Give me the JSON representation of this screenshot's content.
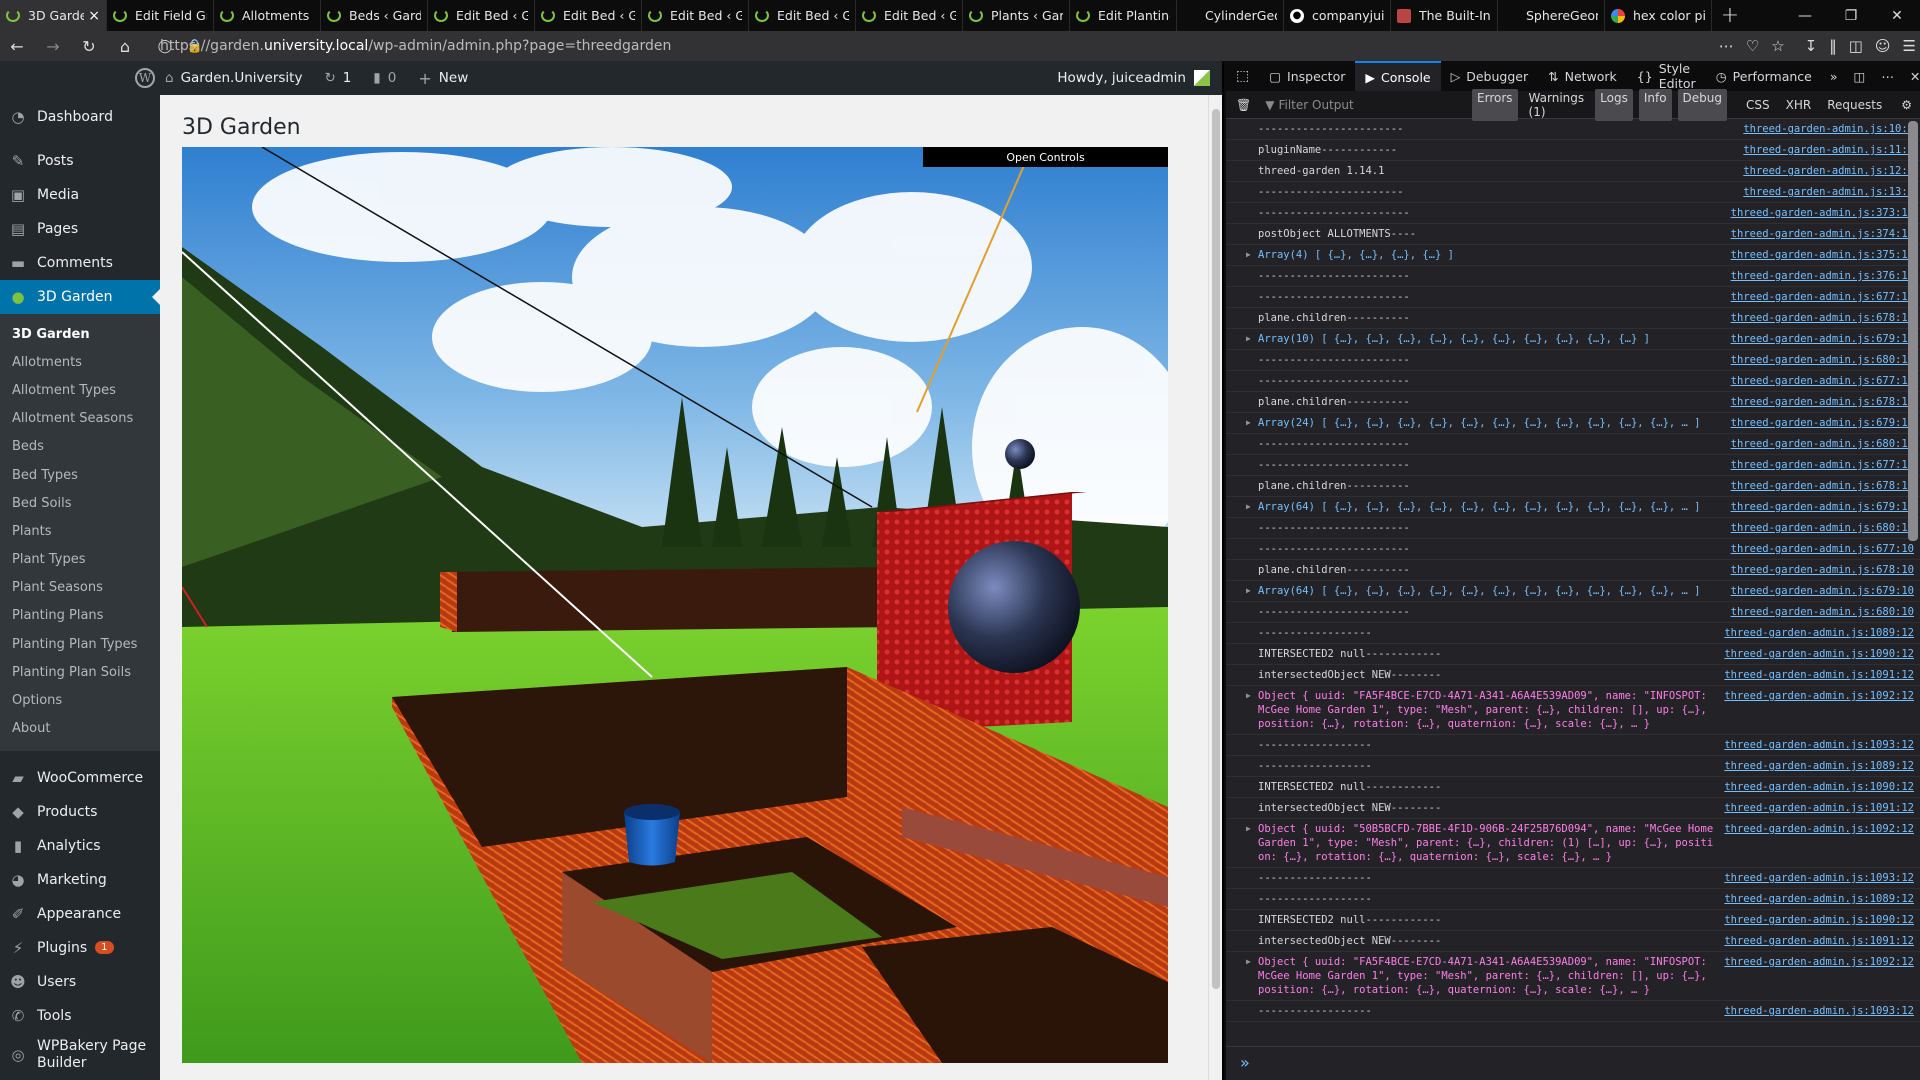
{
  "browser": {
    "tabs": [
      {
        "title": "3D Garden",
        "icon": "wp-icon",
        "active": true
      },
      {
        "title": "Edit Field Gr",
        "icon": "wp-icon"
      },
      {
        "title": "Allotments",
        "icon": "wp-icon"
      },
      {
        "title": "Beds ‹ Garde",
        "icon": "wp-icon"
      },
      {
        "title": "Edit Bed ‹ Ga",
        "icon": "wp-icon"
      },
      {
        "title": "Edit Bed ‹ Ga",
        "icon": "wp-icon"
      },
      {
        "title": "Edit Bed ‹ Ga",
        "icon": "wp-icon"
      },
      {
        "title": "Edit Bed ‹ Ga",
        "icon": "wp-icon"
      },
      {
        "title": "Edit Bed ‹ Ga",
        "icon": "wp-icon"
      },
      {
        "title": "Plants ‹ Gard",
        "icon": "wp-icon"
      },
      {
        "title": "Edit Planting",
        "icon": "wp-icon"
      },
      {
        "title": "CylinderGeo",
        "icon": "threejs-icon"
      },
      {
        "title": "companyjui",
        "icon": "github-icon"
      },
      {
        "title": "The Built-In",
        "icon": "doc-icon"
      },
      {
        "title": "SphereGeom",
        "icon": "threejs-icon"
      },
      {
        "title": "hex color pi",
        "icon": "google-icon"
      }
    ],
    "url_prefix": "https://garden.",
    "url_domain": "university.local",
    "url_path": "/wp-admin/admin.php?page=threedgarden"
  },
  "adminbar": {
    "site_name": "Garden.University",
    "updates": "1",
    "comments": "0",
    "new_label": "New",
    "howdy": "Howdy, juiceadmin"
  },
  "sidebar": {
    "top": [
      {
        "label": "Dashboard",
        "icon": "dashboard-icon"
      }
    ],
    "main": [
      {
        "label": "Posts",
        "icon": "pin-icon"
      },
      {
        "label": "Media",
        "icon": "media-icon"
      },
      {
        "label": "Pages",
        "icon": "pages-icon"
      },
      {
        "label": "Comments",
        "icon": "comment-icon"
      },
      {
        "label": "3D Garden",
        "icon": "garden-icon",
        "current": true
      }
    ],
    "submenu": [
      "3D Garden",
      "Allotments",
      "Allotment Types",
      "Allotment Seasons",
      "Beds",
      "Bed Types",
      "Bed Soils",
      "Plants",
      "Plant Types",
      "Plant Seasons",
      "Planting Plans",
      "Planting Plan Types",
      "Planting Plan Soils",
      "Options",
      "About"
    ],
    "lower": [
      {
        "label": "WooCommerce",
        "icon": "woo-icon"
      },
      {
        "label": "Products",
        "icon": "products-icon"
      },
      {
        "label": "Analytics",
        "icon": "analytics-icon"
      },
      {
        "label": "Marketing",
        "icon": "marketing-icon"
      },
      {
        "label": "Appearance",
        "icon": "brush-icon"
      },
      {
        "label": "Plugins",
        "icon": "plugin-icon",
        "badge": "1"
      },
      {
        "label": "Users",
        "icon": "users-icon"
      },
      {
        "label": "Tools",
        "icon": "wrench-icon"
      },
      {
        "label": "WPBakery Page Builder",
        "icon": "builder-icon"
      }
    ]
  },
  "page": {
    "title": "3D Garden",
    "open_controls": "Open Controls"
  },
  "devtools": {
    "tabs": [
      "Inspector",
      "Console",
      "Debugger",
      "Network",
      "Style Editor",
      "Performance"
    ],
    "active_tab": "Console",
    "filter_placeholder": "Filter Output",
    "levels": [
      {
        "label": "Errors",
        "on": true
      },
      {
        "label": "Warnings (1)",
        "on": false
      },
      {
        "label": "Logs",
        "on": true
      },
      {
        "label": "Info",
        "on": true
      },
      {
        "label": "Debug",
        "on": true
      }
    ],
    "extra_filters": [
      "CSS",
      "XHR",
      "Requests"
    ],
    "log": [
      {
        "text": "-----------------------",
        "src": "threed-garden-admin.js:10:9"
      },
      {
        "text": "pluginName------------",
        "src": "threed-garden-admin.js:11:9"
      },
      {
        "text": "threed-garden 1.14.1",
        "src": "threed-garden-admin.js:12:9"
      },
      {
        "text": "-----------------------",
        "src": "threed-garden-admin.js:13:9"
      },
      {
        "text": "------------------------",
        "src": "threed-garden-admin.js:373:10"
      },
      {
        "text": "postObject ALLOTMENTS----",
        "src": "threed-garden-admin.js:374:10"
      },
      {
        "text": "Array(4) [ {…}, {…}, {…}, {…} ]",
        "src": "threed-garden-admin.js:375:10",
        "kind": "array"
      },
      {
        "text": "------------------------",
        "src": "threed-garden-admin.js:376:10"
      },
      {
        "text": "------------------------",
        "src": "threed-garden-admin.js:677:10"
      },
      {
        "text": "plane.children----------",
        "src": "threed-garden-admin.js:678:10"
      },
      {
        "text": "Array(10) [ {…}, {…}, {…}, {…}, {…}, {…}, {…}, {…}, {…}, {…} ]",
        "src": "threed-garden-admin.js:679:10",
        "kind": "array"
      },
      {
        "text": "------------------------",
        "src": "threed-garden-admin.js:680:10"
      },
      {
        "text": "------------------------",
        "src": "threed-garden-admin.js:677:10"
      },
      {
        "text": "plane.children----------",
        "src": "threed-garden-admin.js:678:10"
      },
      {
        "text": "Array(24) [ {…}, {…}, {…}, {…}, {…}, {…}, {…}, {…}, {…}, {…}, {…}, … ]",
        "src": "threed-garden-admin.js:679:10",
        "kind": "array"
      },
      {
        "text": "------------------------",
        "src": "threed-garden-admin.js:680:10"
      },
      {
        "text": "------------------------",
        "src": "threed-garden-admin.js:677:10"
      },
      {
        "text": "plane.children----------",
        "src": "threed-garden-admin.js:678:10"
      },
      {
        "text": "Array(64) [ {…}, {…}, {…}, {…}, {…}, {…}, {…}, {…}, {…}, {…}, {…}, … ]",
        "src": "threed-garden-admin.js:679:10",
        "kind": "array"
      },
      {
        "text": "------------------------",
        "src": "threed-garden-admin.js:680:10"
      },
      {
        "text": "------------------------",
        "src": "threed-garden-admin.js:677:10"
      },
      {
        "text": "plane.children----------",
        "src": "threed-garden-admin.js:678:10"
      },
      {
        "text": "Array(64) [ {…}, {…}, {…}, {…}, {…}, {…}, {…}, {…}, {…}, {…}, {…}, … ]",
        "src": "threed-garden-admin.js:679:10",
        "kind": "array"
      },
      {
        "text": "------------------------",
        "src": "threed-garden-admin.js:680:10"
      },
      {
        "text": "------------------",
        "src": "threed-garden-admin.js:1089:12"
      },
      {
        "text": "INTERSECTED2 null------------",
        "src": "threed-garden-admin.js:1090:12"
      },
      {
        "text": "intersectedObject NEW--------",
        "src": "threed-garden-admin.js:1091:12"
      },
      {
        "text": "Object { uuid: \"FA5F4BCE-E7CD-4A71-A341-A6A4E539AD09\", name: \"INFOSPOT: McGee Home Garden 1\", type: \"Mesh\", parent: {…}, children: [], up: {…}, position: {…}, rotation: {…}, quaternion: {…}, scale: {…}, … }",
        "src": "threed-garden-admin.js:1092:12",
        "kind": "object"
      },
      {
        "text": "------------------",
        "src": "threed-garden-admin.js:1093:12"
      },
      {
        "text": "------------------",
        "src": "threed-garden-admin.js:1089:12"
      },
      {
        "text": "INTERSECTED2 null------------",
        "src": "threed-garden-admin.js:1090:12"
      },
      {
        "text": "intersectedObject NEW--------",
        "src": "threed-garden-admin.js:1091:12"
      },
      {
        "text": "Object { uuid: \"50B5BCFD-7BBE-4F1D-906B-24F25B76D094\", name: \"McGee Home Garden 1\", type: \"Mesh\", parent: {…}, children: (1) […], up: {…}, position: {…}, rotation: {…}, quaternion: {…}, scale: {…}, … }",
        "src": "threed-garden-admin.js:1092:12",
        "kind": "object"
      },
      {
        "text": "------------------",
        "src": "threed-garden-admin.js:1093:12"
      },
      {
        "text": "------------------",
        "src": "threed-garden-admin.js:1089:12"
      },
      {
        "text": "INTERSECTED2 null------------",
        "src": "threed-garden-admin.js:1090:12"
      },
      {
        "text": "intersectedObject NEW--------",
        "src": "threed-garden-admin.js:1091:12"
      },
      {
        "text": "Object { uuid: \"FA5F4BCE-E7CD-4A71-A341-A6A4E539AD09\", name: \"INFOSPOT: McGee Home Garden 1\", type: \"Mesh\", parent: {…}, children: [], up: {…}, position: {…}, rotation: {…}, quaternion: {…}, scale: {…}, … }",
        "src": "threed-garden-admin.js:1092:12",
        "kind": "object"
      },
      {
        "text": "------------------",
        "src": "threed-garden-admin.js:1093:12"
      }
    ]
  },
  "colors": {
    "wp_admin_dark": "#23282d",
    "wp_accent": "#0073aa",
    "devtools_bg": "#232327",
    "console_link": "#75bfff"
  }
}
